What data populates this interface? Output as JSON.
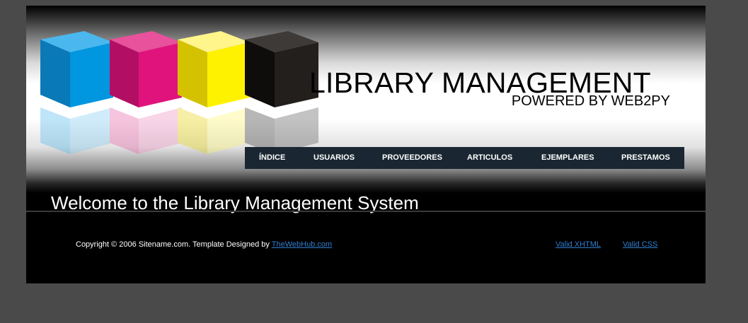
{
  "header": {
    "title": "LIBRARY MANAGEMENT",
    "subtitle": "POWERED BY WEB2PY",
    "logo": "cmyk-cubes"
  },
  "nav": {
    "items": [
      {
        "label": "ÍNDICE"
      },
      {
        "label": "USUARIOS"
      },
      {
        "label": "PROVEEDORES"
      },
      {
        "label": "ARTICULOS"
      },
      {
        "label": "EJEMPLARES"
      },
      {
        "label": "PRESTAMOS"
      }
    ]
  },
  "main": {
    "welcome": "Welcome to the Library Management System"
  },
  "footer": {
    "copyright_text": "Copyright © 2006 Sitename.com. Template Designed by",
    "designer_link": "TheWebHub.com",
    "valid_xhtml": "Valid XHTML",
    "valid_css": "Valid CSS"
  },
  "colors": {
    "background": "#4a4a4a",
    "nav_bar": "#1a2732",
    "link": "#2f7fd0",
    "cube_cyan": "#0096e0",
    "cube_magenta": "#e0137d",
    "cube_yellow": "#fff200",
    "cube_black": "#221f1d"
  }
}
